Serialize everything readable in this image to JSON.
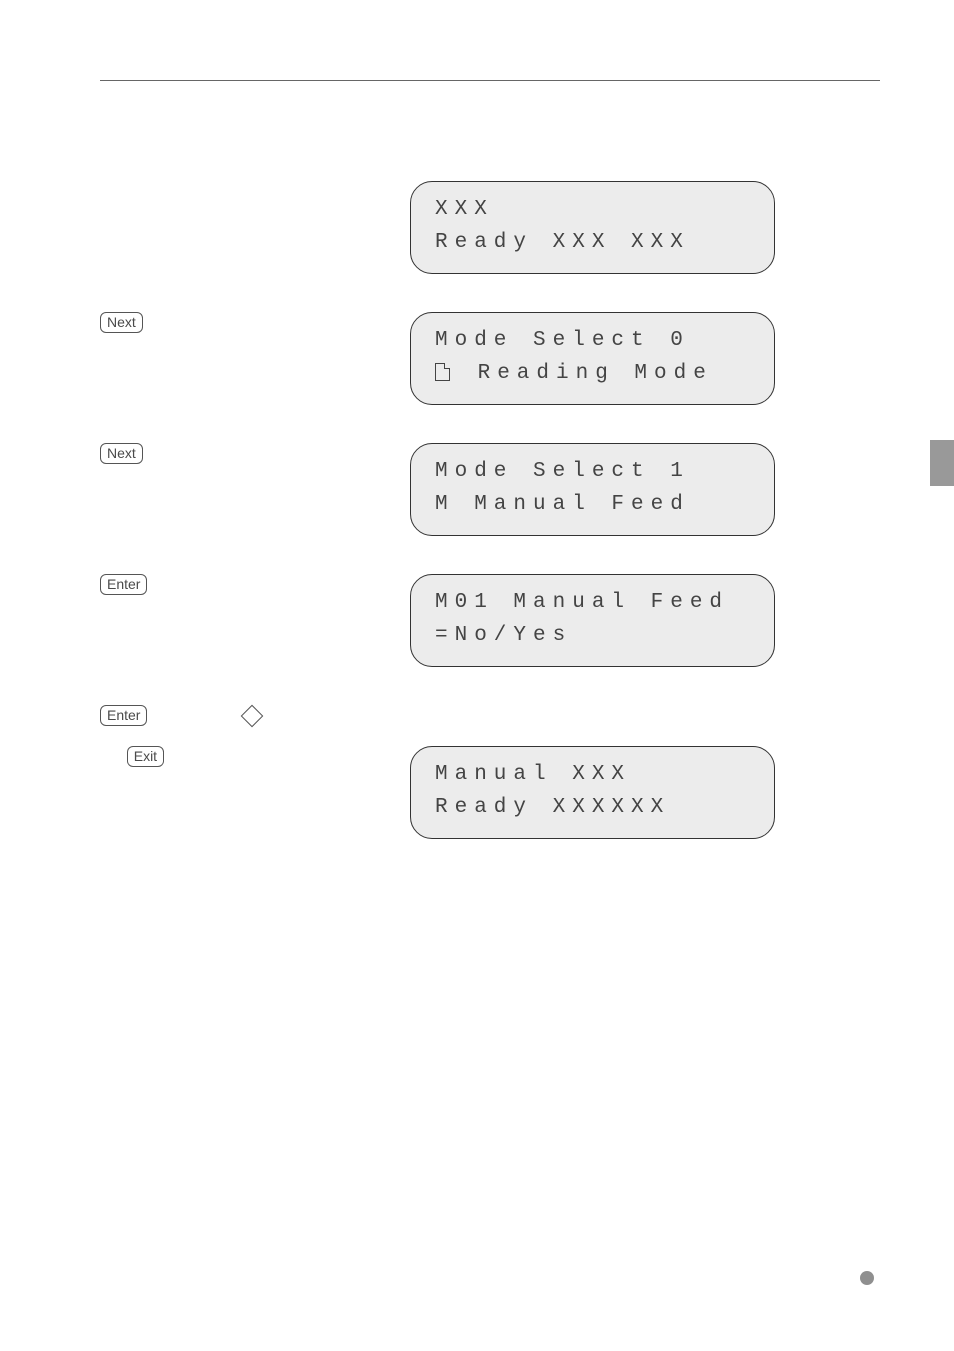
{
  "steps": {
    "s1": {
      "lcd_line1": "        XXX",
      "lcd_line2": "Ready XXX XXX"
    },
    "s2": {
      "key": "Next",
      "lcd_line1": " Mode Select 0",
      "lcd_line2": " Reading Mode"
    },
    "s3": {
      "key": "Next",
      "lcd_line1": "  Mode Select 1",
      "lcd_line2": "M Manual Feed"
    },
    "s4": {
      "key": "Enter",
      "lcd_line1": "M01 Manual Feed",
      "lcd_line2": " =No/Yes"
    },
    "s5": {
      "key1": "Enter"
    },
    "s6": {
      "key": "Exit",
      "lcd_line1": "  Manual XXX",
      "lcd_line2": "Ready XXXXXX"
    }
  }
}
